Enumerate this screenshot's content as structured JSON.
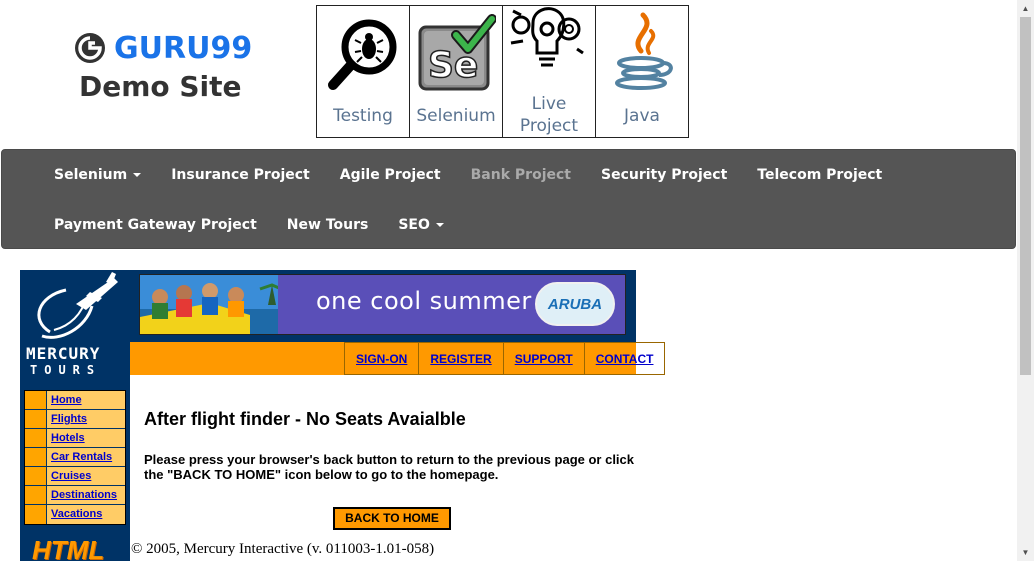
{
  "logo": {
    "brand": "GURU99",
    "subtitle": "Demo Site"
  },
  "tiles": [
    {
      "label": "Testing",
      "icon": "magnifier-bug-icon"
    },
    {
      "label": "Selenium",
      "icon": "selenium-icon"
    },
    {
      "label_line1": "Live",
      "label_line2": "Project",
      "icon": "lightbulb-gears-icon"
    },
    {
      "label": "Java",
      "icon": "java-icon"
    }
  ],
  "nav": {
    "row1": [
      {
        "label": "Selenium",
        "dropdown": true
      },
      {
        "label": "Insurance Project"
      },
      {
        "label": "Agile Project"
      },
      {
        "label": "Bank Project"
      },
      {
        "label": "Security Project"
      },
      {
        "label": "Telecom Project"
      }
    ],
    "row2": [
      {
        "label": "Payment Gateway Project"
      },
      {
        "label": "New Tours"
      },
      {
        "label": "SEO",
        "dropdown": true
      }
    ]
  },
  "mercury": {
    "brand_line1": "MERCURY",
    "brand_line2": "TOURS",
    "menu": [
      "Home",
      "Flights",
      "Hotels",
      "Car Rentals",
      "Cruises",
      "Destinations",
      "Vacations"
    ],
    "html_badge": "HTML",
    "banner_text": "one cool summer",
    "banner_logo": "ARUBA",
    "top_links": [
      "SIGN-ON",
      "REGISTER",
      "SUPPORT",
      "CONTACT"
    ],
    "heading": "After flight finder - No Seats Avaialble",
    "paragraph": "Please press your browser's back button to return to the previous page or click the \"BACK TO HOME\" icon below to go to the homepage.",
    "back_button": "BACK TO HOME",
    "copyright": "© 2005, Mercury Interactive (v. 011003-1.01-058)"
  },
  "colors": {
    "nav_bg": "#555555",
    "guru_blue": "#1a73e8",
    "mercury_navy": "#003366",
    "mercury_orange": "#ff9900",
    "menu_bg": "#ffcc66",
    "link_blue": "#0000cc"
  }
}
